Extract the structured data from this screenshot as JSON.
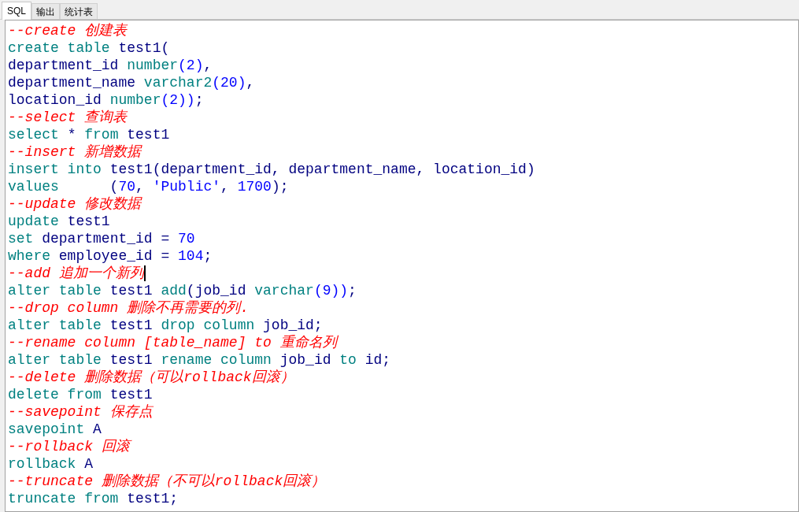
{
  "tabs": [
    {
      "label": "SQL",
      "selected": true
    },
    {
      "label": "输出",
      "selected": false
    },
    {
      "label": "统计表",
      "selected": false
    }
  ],
  "editor": {
    "lines": [
      {
        "caret": false,
        "tokens": [
          {
            "kind": "comment",
            "text": "--create 创建表"
          }
        ]
      },
      {
        "caret": false,
        "tokens": [
          {
            "kind": "keyword",
            "text": "create table "
          },
          {
            "kind": "identifier",
            "text": "test1("
          }
        ]
      },
      {
        "caret": false,
        "tokens": [
          {
            "kind": "identifier",
            "text": "department_id "
          },
          {
            "kind": "keyword",
            "text": "number"
          },
          {
            "kind": "number",
            "text": "(2)"
          },
          {
            "kind": "identifier",
            "text": ","
          }
        ]
      },
      {
        "caret": false,
        "tokens": [
          {
            "kind": "identifier",
            "text": "department_name "
          },
          {
            "kind": "keyword",
            "text": "varchar2"
          },
          {
            "kind": "number",
            "text": "(20)"
          },
          {
            "kind": "identifier",
            "text": ","
          }
        ]
      },
      {
        "caret": false,
        "tokens": [
          {
            "kind": "identifier",
            "text": "location_id "
          },
          {
            "kind": "keyword",
            "text": "number"
          },
          {
            "kind": "number",
            "text": "(2))"
          },
          {
            "kind": "identifier",
            "text": ";"
          }
        ]
      },
      {
        "caret": false,
        "tokens": [
          {
            "kind": "comment",
            "text": "--select 查询表"
          }
        ]
      },
      {
        "caret": false,
        "tokens": [
          {
            "kind": "keyword",
            "text": "select "
          },
          {
            "kind": "identifier",
            "text": "* "
          },
          {
            "kind": "keyword",
            "text": "from "
          },
          {
            "kind": "identifier",
            "text": "test1"
          }
        ]
      },
      {
        "caret": false,
        "tokens": [
          {
            "kind": "comment",
            "text": "--insert 新增数据"
          }
        ]
      },
      {
        "caret": false,
        "tokens": [
          {
            "kind": "keyword",
            "text": "insert into "
          },
          {
            "kind": "identifier",
            "text": "test1(department_id, department_name, location_id)"
          }
        ]
      },
      {
        "caret": false,
        "tokens": [
          {
            "kind": "keyword",
            "text": "values"
          },
          {
            "kind": "identifier",
            "text": "      ("
          },
          {
            "kind": "number",
            "text": "70"
          },
          {
            "kind": "identifier",
            "text": ", "
          },
          {
            "kind": "string",
            "text": "'Public'"
          },
          {
            "kind": "identifier",
            "text": ", "
          },
          {
            "kind": "number",
            "text": "1700"
          },
          {
            "kind": "identifier",
            "text": ");"
          }
        ]
      },
      {
        "caret": false,
        "tokens": [
          {
            "kind": "comment",
            "text": "--update 修改数据"
          }
        ]
      },
      {
        "caret": false,
        "tokens": [
          {
            "kind": "keyword",
            "text": "update "
          },
          {
            "kind": "identifier",
            "text": "test1"
          }
        ]
      },
      {
        "caret": false,
        "tokens": [
          {
            "kind": "keyword",
            "text": "set "
          },
          {
            "kind": "identifier",
            "text": "department_id = "
          },
          {
            "kind": "number",
            "text": "70"
          }
        ]
      },
      {
        "caret": false,
        "tokens": [
          {
            "kind": "keyword",
            "text": "where "
          },
          {
            "kind": "identifier",
            "text": "employee_id = "
          },
          {
            "kind": "number",
            "text": "104"
          },
          {
            "kind": "identifier",
            "text": ";"
          }
        ]
      },
      {
        "caret": true,
        "tokens": [
          {
            "kind": "comment",
            "text": "--add 追加一个新列"
          }
        ]
      },
      {
        "caret": false,
        "tokens": [
          {
            "kind": "keyword",
            "text": "alter table "
          },
          {
            "kind": "identifier",
            "text": "test1 "
          },
          {
            "kind": "keyword",
            "text": "add"
          },
          {
            "kind": "identifier",
            "text": "(job_id "
          },
          {
            "kind": "keyword",
            "text": "varchar"
          },
          {
            "kind": "number",
            "text": "(9))"
          },
          {
            "kind": "identifier",
            "text": ";"
          }
        ]
      },
      {
        "caret": false,
        "tokens": [
          {
            "kind": "comment",
            "text": "--drop column 删除不再需要的列."
          }
        ]
      },
      {
        "caret": false,
        "tokens": [
          {
            "kind": "keyword",
            "text": "alter table "
          },
          {
            "kind": "identifier",
            "text": "test1 "
          },
          {
            "kind": "keyword",
            "text": "drop column "
          },
          {
            "kind": "identifier",
            "text": "job_id;"
          }
        ]
      },
      {
        "caret": false,
        "tokens": [
          {
            "kind": "comment",
            "text": "--rename column [table_name] to 重命名列"
          }
        ]
      },
      {
        "caret": false,
        "tokens": [
          {
            "kind": "keyword",
            "text": "alter table "
          },
          {
            "kind": "identifier",
            "text": "test1 "
          },
          {
            "kind": "keyword",
            "text": "rename column "
          },
          {
            "kind": "identifier",
            "text": "job_id "
          },
          {
            "kind": "keyword",
            "text": "to "
          },
          {
            "kind": "identifier",
            "text": "id;"
          }
        ]
      },
      {
        "caret": false,
        "tokens": [
          {
            "kind": "comment",
            "text": "--delete 删除数据（可以rollback回滚）"
          }
        ]
      },
      {
        "caret": false,
        "tokens": [
          {
            "kind": "keyword",
            "text": "delete from "
          },
          {
            "kind": "identifier",
            "text": "test1"
          }
        ]
      },
      {
        "caret": false,
        "tokens": [
          {
            "kind": "comment",
            "text": "--savepoint 保存点"
          }
        ]
      },
      {
        "caret": false,
        "tokens": [
          {
            "kind": "keyword",
            "text": "savepoint "
          },
          {
            "kind": "identifier",
            "text": "A"
          }
        ]
      },
      {
        "caret": false,
        "tokens": [
          {
            "kind": "comment",
            "text": "--rollback 回滚"
          }
        ]
      },
      {
        "caret": false,
        "tokens": [
          {
            "kind": "keyword",
            "text": "rollback "
          },
          {
            "kind": "identifier",
            "text": "A"
          }
        ]
      },
      {
        "caret": false,
        "tokens": [
          {
            "kind": "comment",
            "text": "--truncate 删除数据（不可以rollback回滚）"
          }
        ]
      },
      {
        "caret": false,
        "tokens": [
          {
            "kind": "keyword",
            "text": "truncate from "
          },
          {
            "kind": "identifier",
            "text": "test1;"
          }
        ]
      }
    ]
  }
}
